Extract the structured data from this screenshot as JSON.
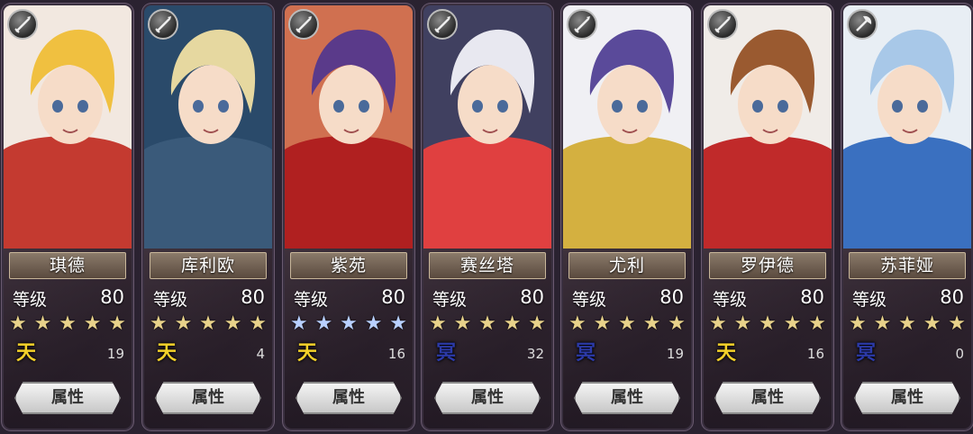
{
  "level_label": "等级",
  "attribute_button_label": "属性",
  "characters": [
    {
      "name": "琪德",
      "level": "80",
      "rank_glyph": "天",
      "rank_color": "#f3d12a",
      "count": "19",
      "star_color": "#e8d28a",
      "stars": 5,
      "weapon_icon": "sword-icon",
      "palette": {
        "bg": "#f2e8e0",
        "hair": "#f0c040",
        "accent": "#c43a30"
      }
    },
    {
      "name": "库利欧",
      "level": "80",
      "rank_glyph": "天",
      "rank_color": "#f3d12a",
      "count": "4",
      "star_color": "#e8d28a",
      "stars": 5,
      "weapon_icon": "sword-icon",
      "palette": {
        "bg": "#2a4a6a",
        "hair": "#e6d8a0",
        "accent": "#3a5a7a"
      }
    },
    {
      "name": "紫苑",
      "level": "80",
      "rank_glyph": "天",
      "rank_color": "#f3d12a",
      "count": "16",
      "star_color": "#b8d0ff",
      "stars": 5,
      "weapon_icon": "sword-icon",
      "palette": {
        "bg": "#d07050",
        "hair": "#5a3a8a",
        "accent": "#b02020"
      }
    },
    {
      "name": "赛丝塔",
      "level": "80",
      "rank_glyph": "冥",
      "rank_color": "#2c3aa8",
      "count": "32",
      "star_color": "#e8d28a",
      "stars": 5,
      "weapon_icon": "sword-icon",
      "palette": {
        "bg": "#404060",
        "hair": "#e8e8f0",
        "accent": "#e04040"
      }
    },
    {
      "name": "尤利",
      "level": "80",
      "rank_glyph": "冥",
      "rank_color": "#2c3aa8",
      "count": "19",
      "star_color": "#e8d28a",
      "stars": 5,
      "weapon_icon": "sword-icon",
      "palette": {
        "bg": "#f0f0f4",
        "hair": "#5a4a9a",
        "accent": "#d4b040"
      }
    },
    {
      "name": "罗伊德",
      "level": "80",
      "rank_glyph": "天",
      "rank_color": "#f3d12a",
      "count": "16",
      "star_color": "#e8d28a",
      "stars": 5,
      "weapon_icon": "sword-icon",
      "palette": {
        "bg": "#f0ece8",
        "hair": "#9a5a30",
        "accent": "#c02a2a"
      }
    },
    {
      "name": "苏菲娅",
      "level": "80",
      "rank_glyph": "冥",
      "rank_color": "#2c3aa8",
      "count": "0",
      "star_color": "#e8d28a",
      "stars": 5,
      "weapon_icon": "axe-icon",
      "palette": {
        "bg": "#e8eef4",
        "hair": "#a8c8e8",
        "accent": "#3a70c0"
      }
    }
  ]
}
